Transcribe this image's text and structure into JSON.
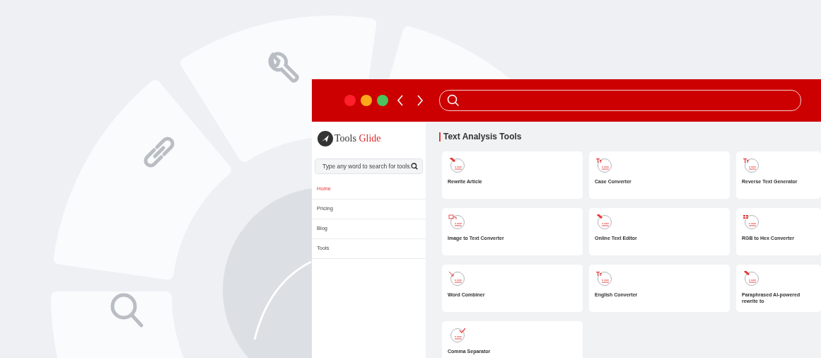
{
  "brand": {
    "name": "Tools",
    "accent": "Glide"
  },
  "search": {
    "placeholder": "Type any word to search for tools."
  },
  "nav": [
    {
      "label": "Home",
      "selected": true
    },
    {
      "label": "Pricing",
      "selected": false
    },
    {
      "label": "Blog",
      "selected": false
    },
    {
      "label": "Tools",
      "selected": false
    }
  ],
  "section": {
    "title": "Text Analysis Tools"
  },
  "tools": [
    {
      "title": "Rewrite Article",
      "kind": "pencil"
    },
    {
      "title": "Case Converter",
      "kind": "letters"
    },
    {
      "title": "Reverse Text Generator",
      "kind": "letters"
    },
    {
      "title": "Image to Text Converter",
      "kind": "image"
    },
    {
      "title": "Online Text Editor",
      "kind": "pencil"
    },
    {
      "title": "RGB to Hex Converter",
      "kind": "grid"
    },
    {
      "title": "Word Combiner",
      "kind": "arrow"
    },
    {
      "title": "English Converter",
      "kind": "letters"
    },
    {
      "title": "Paraphrased AI-powered rewrite to",
      "kind": "pencil"
    },
    {
      "title": "Comma Separator",
      "kind": "check"
    }
  ]
}
